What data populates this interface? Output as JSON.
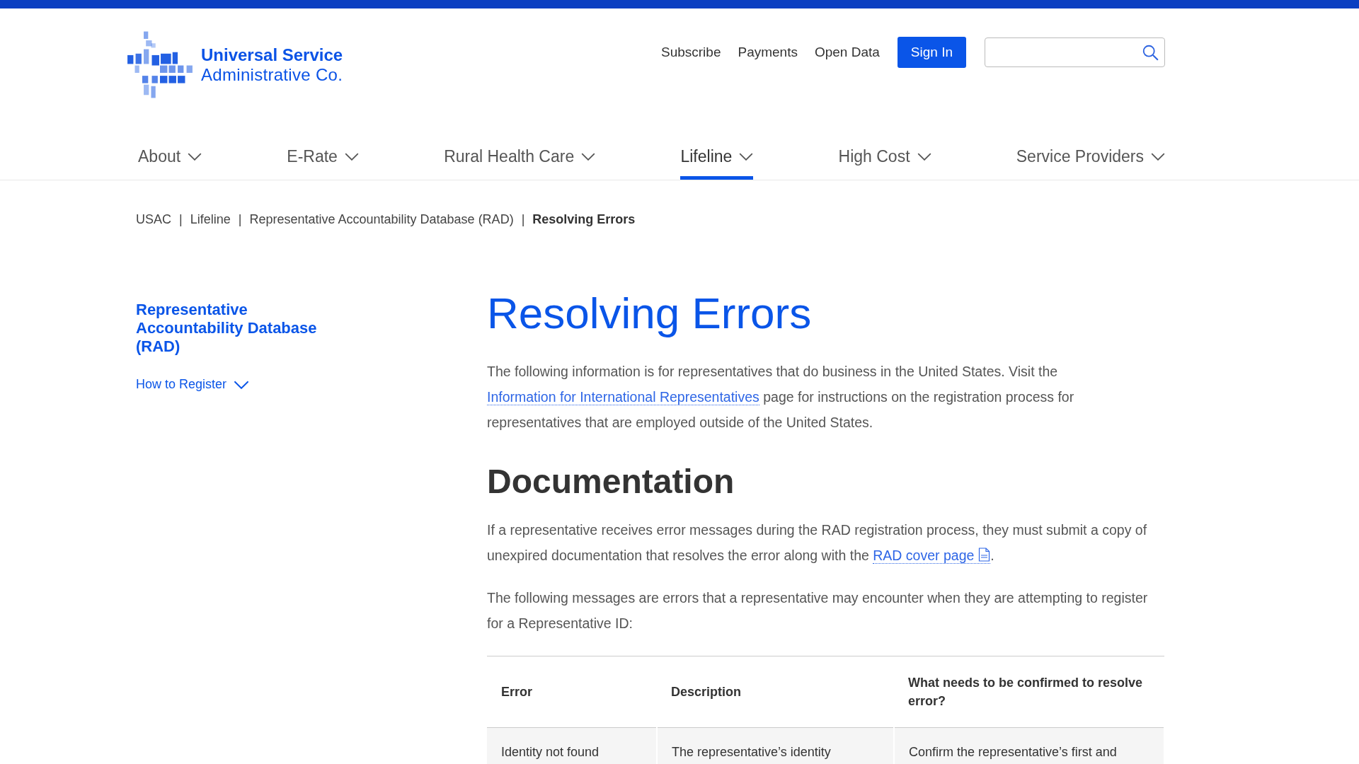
{
  "logo": {
    "lines": [
      "Universal Service",
      "Administrative Co."
    ]
  },
  "utility_links": [
    "Subscribe",
    "Payments",
    "Open Data"
  ],
  "sign_in": "Sign In",
  "nav": [
    {
      "label": "About",
      "selected": false
    },
    {
      "label": "E-Rate",
      "selected": false
    },
    {
      "label": "Rural Health Care",
      "selected": false
    },
    {
      "label": "Lifeline",
      "selected": true
    },
    {
      "label": "High Cost",
      "selected": false
    },
    {
      "label": "Service Providers",
      "selected": false
    }
  ],
  "breadcrumb": [
    {
      "label": "USAC",
      "current": false
    },
    {
      "label": "Lifeline",
      "current": false
    },
    {
      "label": "Representative Accountability Database (RAD)",
      "current": false
    },
    {
      "label": "Resolving Errors",
      "current": true
    }
  ],
  "breadcrumb_separator": "|",
  "sidebar": {
    "title": "Representative Accountability Database (RAD)",
    "items": [
      {
        "label": "How to Register",
        "expanded": false
      }
    ]
  },
  "content": {
    "title": "Resolving Errors",
    "intro": [
      {
        "kind": "text",
        "text": "The following information is for representatives that do business in the United States. Visit the "
      },
      {
        "kind": "link",
        "text": "Information for International Representatives",
        "pdf": false
      },
      {
        "kind": "text",
        "text": " page for instructions on the registration process for representatives that are employed outside of the United States."
      }
    ],
    "section_title": "Documentation",
    "paragraphs": [
      [
        {
          "kind": "text",
          "text": "If a representative receives error messages during the RAD registration process, they must submit a copy of unexpired documentation that resolves the error along with the "
        },
        {
          "kind": "link",
          "text": "RAD cover page",
          "pdf": true
        },
        {
          "kind": "text",
          "text": "."
        }
      ],
      [
        {
          "kind": "text",
          "text": "The following messages are errors that a representative may encounter when they are attempting to register for a Representative ID:"
        }
      ]
    ],
    "table": {
      "columns": [
        "Error",
        "Description",
        "What needs to be confirmed to resolve error?"
      ],
      "rows": [
        [
          "Identity not found",
          "The representative’s identity",
          "Confirm the representative’s first and"
        ]
      ]
    }
  }
}
